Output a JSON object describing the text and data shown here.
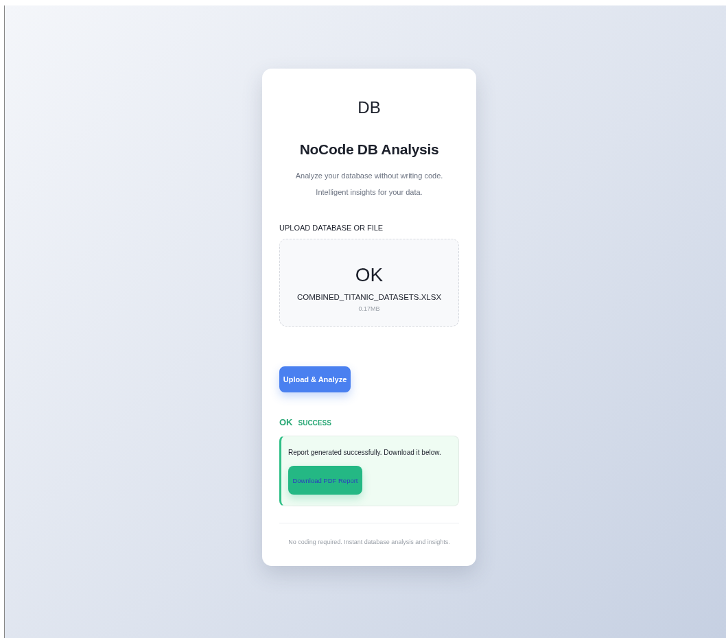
{
  "logo": "DB",
  "title": "NoCode DB Analysis",
  "subtitle": "Analyze your database without writing code. Intelligent insights for your data.",
  "upload": {
    "label": "UPLOAD DATABASE OR FILE",
    "status": "OK",
    "file_name": "COMBINED_TITANIC_DATASETS.XLSX",
    "file_size": "0.17MB"
  },
  "analyze_button": "Upload & Analyze",
  "result": {
    "kind": "success",
    "icon": "OK",
    "heading": "SUCCESS",
    "message": "Report generated successfully. Download it below.",
    "download_button": "Download PDF Report"
  },
  "footer": "No coding required. Instant database analysis and insights."
}
